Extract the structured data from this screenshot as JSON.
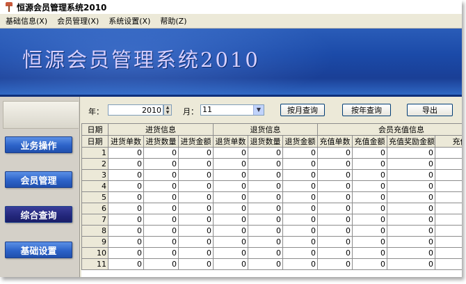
{
  "window": {
    "title": "恒源会员管理系统2010"
  },
  "menu": [
    "基础信息(X)",
    "会员管理(X)",
    "系统设置(X)",
    "帮助(Z)"
  ],
  "banner": {
    "title": "恒源会员管理系统2010"
  },
  "sidebar": {
    "items": [
      "业务操作",
      "会员管理",
      "综合查询",
      "基础设置"
    ],
    "active_index": 2
  },
  "filters": {
    "year_label": "年：",
    "year_value": "2010",
    "month_label": "月：",
    "month_value": "11"
  },
  "buttons": {
    "monthly_query": "按月查询",
    "yearly_query": "按年查询",
    "export": "导出"
  },
  "table": {
    "group_header_date": "日期",
    "groups": [
      "进货信息",
      "退货信息",
      "会员充值信息"
    ],
    "columns": [
      "日期",
      "进货单数",
      "进货数量",
      "进货金额",
      "退货单数",
      "退货数量",
      "退货金额",
      "充值单数",
      "充值金额",
      "充值奖励金额",
      "充值"
    ],
    "rows": [
      [
        "1",
        "0",
        "0",
        "0",
        "0",
        "0",
        "0",
        "0",
        "0",
        "0"
      ],
      [
        "2",
        "0",
        "0",
        "0",
        "0",
        "0",
        "0",
        "0",
        "0",
        "0"
      ],
      [
        "3",
        "0",
        "0",
        "0",
        "0",
        "0",
        "0",
        "0",
        "0",
        "0"
      ],
      [
        "4",
        "0",
        "0",
        "0",
        "0",
        "0",
        "0",
        "0",
        "0",
        "0"
      ],
      [
        "5",
        "0",
        "0",
        "0",
        "0",
        "0",
        "0",
        "0",
        "0",
        "0"
      ],
      [
        "6",
        "0",
        "0",
        "0",
        "0",
        "0",
        "0",
        "0",
        "0",
        "0"
      ],
      [
        "7",
        "0",
        "0",
        "0",
        "0",
        "0",
        "0",
        "0",
        "0",
        "0"
      ],
      [
        "8",
        "0",
        "0",
        "0",
        "0",
        "0",
        "0",
        "0",
        "0",
        "0"
      ],
      [
        "9",
        "0",
        "0",
        "0",
        "0",
        "0",
        "0",
        "0",
        "0",
        "0"
      ],
      [
        "10",
        "0",
        "0",
        "0",
        "0",
        "0",
        "0",
        "0",
        "0",
        "0"
      ],
      [
        "11",
        "0",
        "0",
        "0",
        "0",
        "0",
        "0",
        "0",
        "0",
        "0"
      ]
    ]
  },
  "colors": {
    "banner": "#1b4aa8",
    "sidebar_button": "#2c62c8",
    "sidebar_active": "#22267a"
  }
}
